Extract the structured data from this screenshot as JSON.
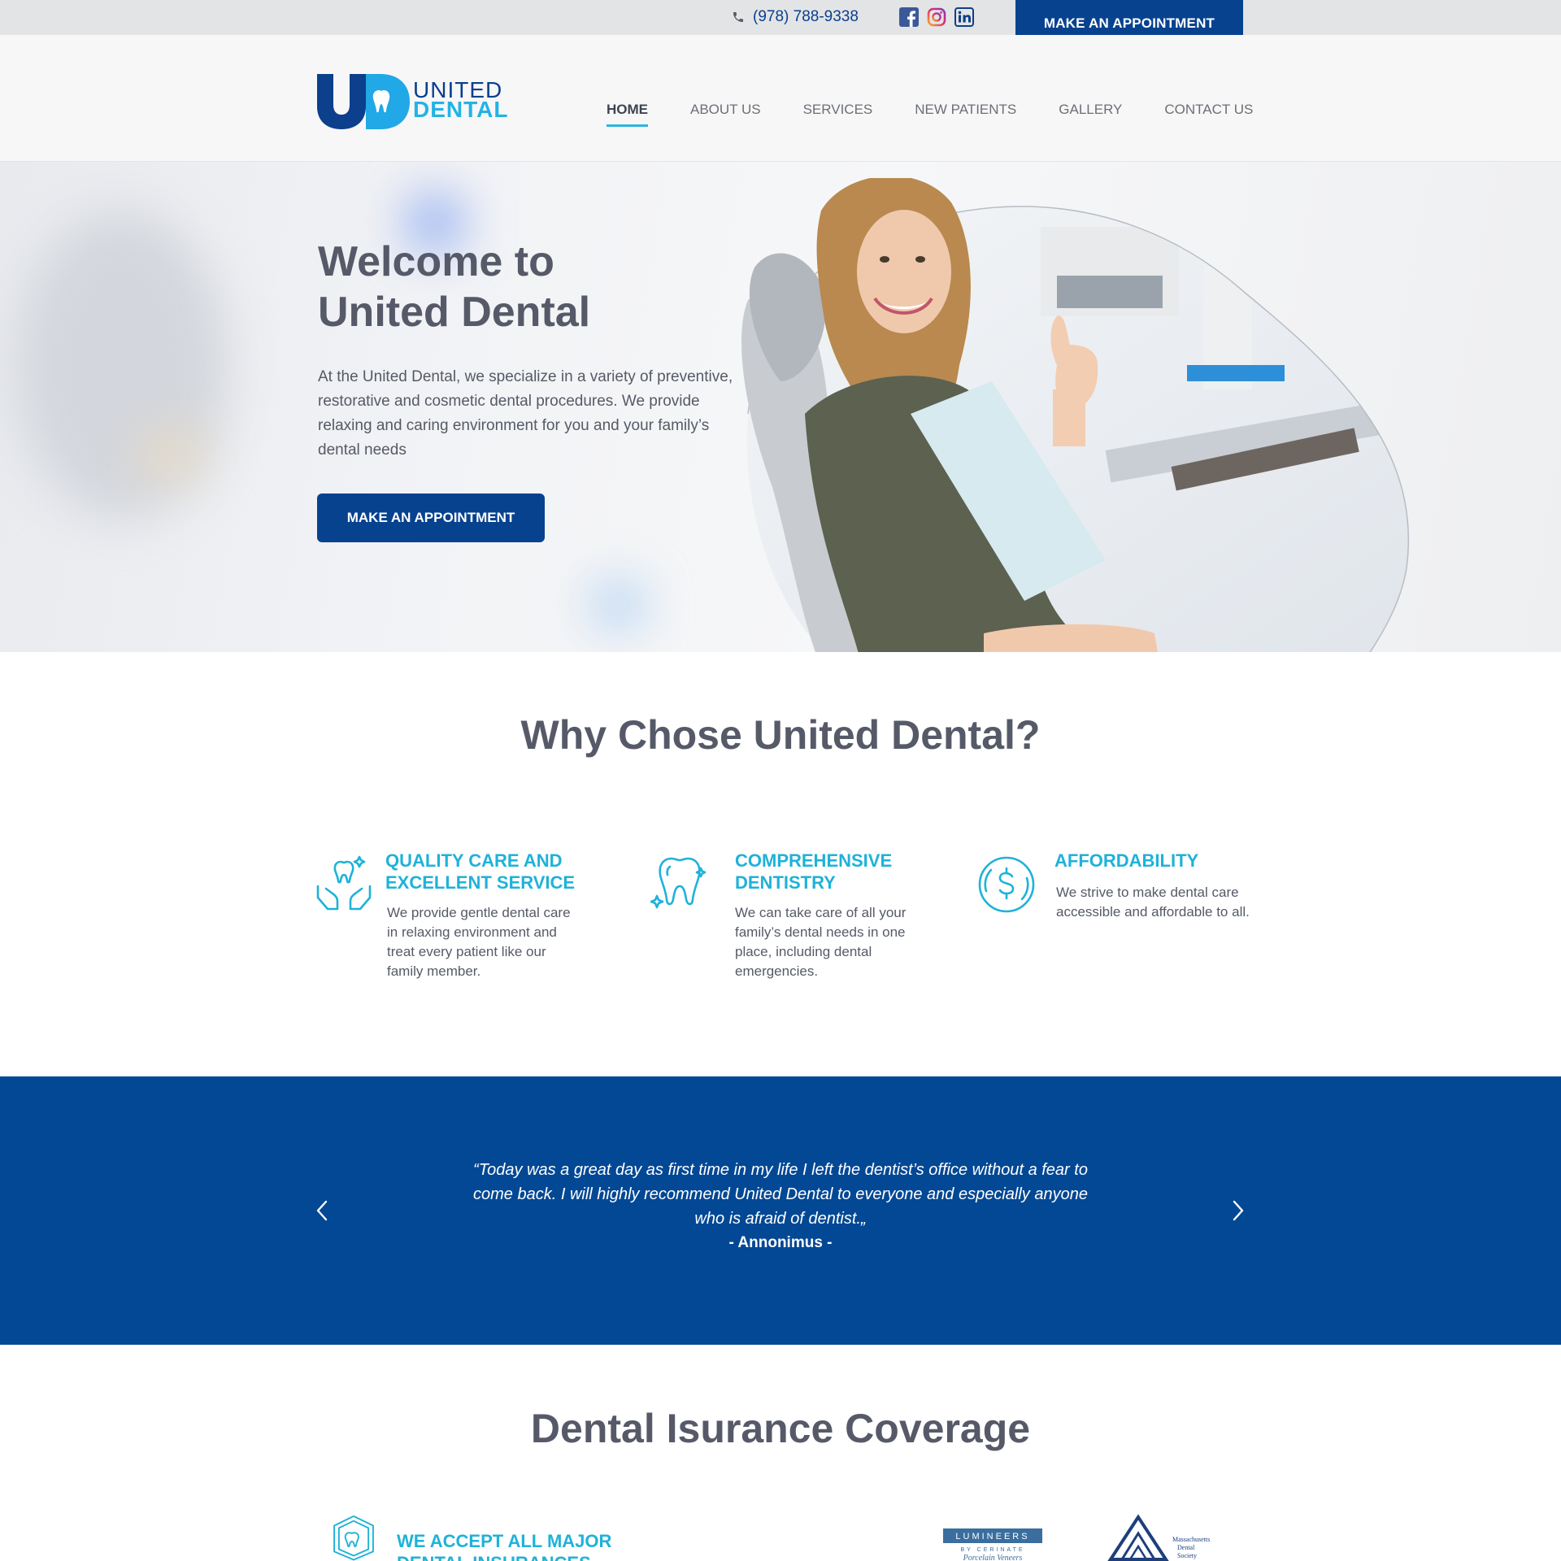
{
  "topbar": {
    "phone": "(978) 788-9338",
    "socials": [
      "facebook-icon",
      "instagram-icon",
      "linkedin-icon"
    ],
    "cta": "MAKE AN APPOINTMENT"
  },
  "header": {
    "logo_mark": "UD",
    "logo_line1": "UNITED",
    "logo_line2": "DENTAL",
    "nav": [
      {
        "label": "HOME",
        "active": true
      },
      {
        "label": "ABOUT US"
      },
      {
        "label": "SERVICES"
      },
      {
        "label": "NEW PATIENTS"
      },
      {
        "label": "GALLERY"
      },
      {
        "label": "CONTACT US"
      }
    ]
  },
  "hero": {
    "title_line1": "Welcome to",
    "title_line2": "United Dental",
    "text": "At the United Dental, we specialize in a variety of preventive, restorative and cosmetic dental procedures. We provide   relaxing and caring environment for you and your family’s dental needs",
    "cta": "MAKE AN APPOINTMENT"
  },
  "why": {
    "title": "Why Chose United Dental?",
    "features": [
      {
        "icon": "hands-tooth-icon",
        "title_line1": "QUALITY CARE AND",
        "title_line2": "EXCELLENT SERVICE",
        "text": "We provide gentle dental care in relaxing environment and treat every patient like our family member."
      },
      {
        "icon": "sparkling-tooth-icon",
        "title_line1": "COMPREHENSIVE",
        "title_line2": "DENTISTRY",
        "text": "We can take care of all your family’s dental needs in one place, including dental emergencies."
      },
      {
        "icon": "dollar-coin-icon",
        "title_line1": "AFFORDABILITY",
        "title_line2": "",
        "text": "We strive to make dental care accessible and affordable to all."
      }
    ]
  },
  "testimonial": {
    "quote": "Today was a great day as first time in my life I left the dentist’s office without a fear to come back. I will highly recommend United Dental to everyone and especially anyone who is afraid of dentist.",
    "open_mark": "“",
    "close_mark": "„",
    "author": "- Annonimus -"
  },
  "insurance": {
    "title": "Dental Isurance Coverage",
    "item_title": "WE ACCEPT ALL MAJOR DENTAL INSURANCES",
    "logos": {
      "lumineers": "LUMINEERS",
      "lumineers_sub": "BY CERINATE",
      "lumineers_script": "Porcelain Veneers",
      "mds_line1": "Massachusetts",
      "mds_line2": "Dental",
      "mds_line3": "Society"
    }
  },
  "colors": {
    "primary": "#07428f",
    "accent": "#1fb2d8",
    "band": "#034894"
  }
}
